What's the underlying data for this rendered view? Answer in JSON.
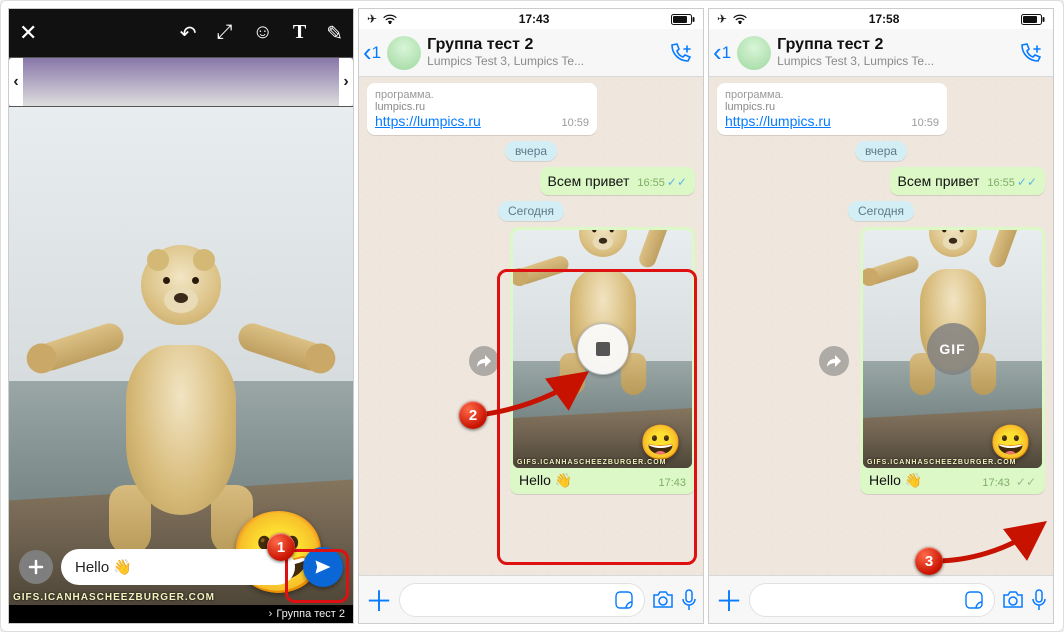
{
  "panel1": {
    "watermark": "GIFS.ICANHASCHEEZBURGER.COM",
    "caption_value": "Hello 👋",
    "recipient_label": "Группа тест 2",
    "emoji": "😀"
  },
  "panel2": {
    "status_time": "17:43",
    "back_count": "1",
    "chat_title": "Группа тест 2",
    "chat_subtitle": "Lumpics Test 3, Lumpics Te...",
    "preview_snippet": "программа.",
    "preview_domain": "lumpics.ru",
    "link_url": "https://lumpics.ru",
    "link_time": "10:59",
    "date1": "вчера",
    "msg1_text": "Всем привет",
    "msg1_time": "16:55",
    "date2": "Сегодня",
    "media_caption": "Hello 👋",
    "media_time": "17:43"
  },
  "panel3": {
    "status_time": "17:58",
    "back_count": "1",
    "chat_title": "Группа тест 2",
    "chat_subtitle": "Lumpics Test 3, Lumpics Te...",
    "preview_snippet": "программа.",
    "preview_domain": "lumpics.ru",
    "link_url": "https://lumpics.ru",
    "link_time": "10:59",
    "date1": "вчера",
    "msg1_text": "Всем привет",
    "msg1_time": "16:55",
    "date2": "Сегодня",
    "gif_label": "GIF",
    "media_caption": "Hello 👋",
    "media_time": "17:43"
  },
  "badges": {
    "b1": "1",
    "b2": "2",
    "b3": "3"
  }
}
